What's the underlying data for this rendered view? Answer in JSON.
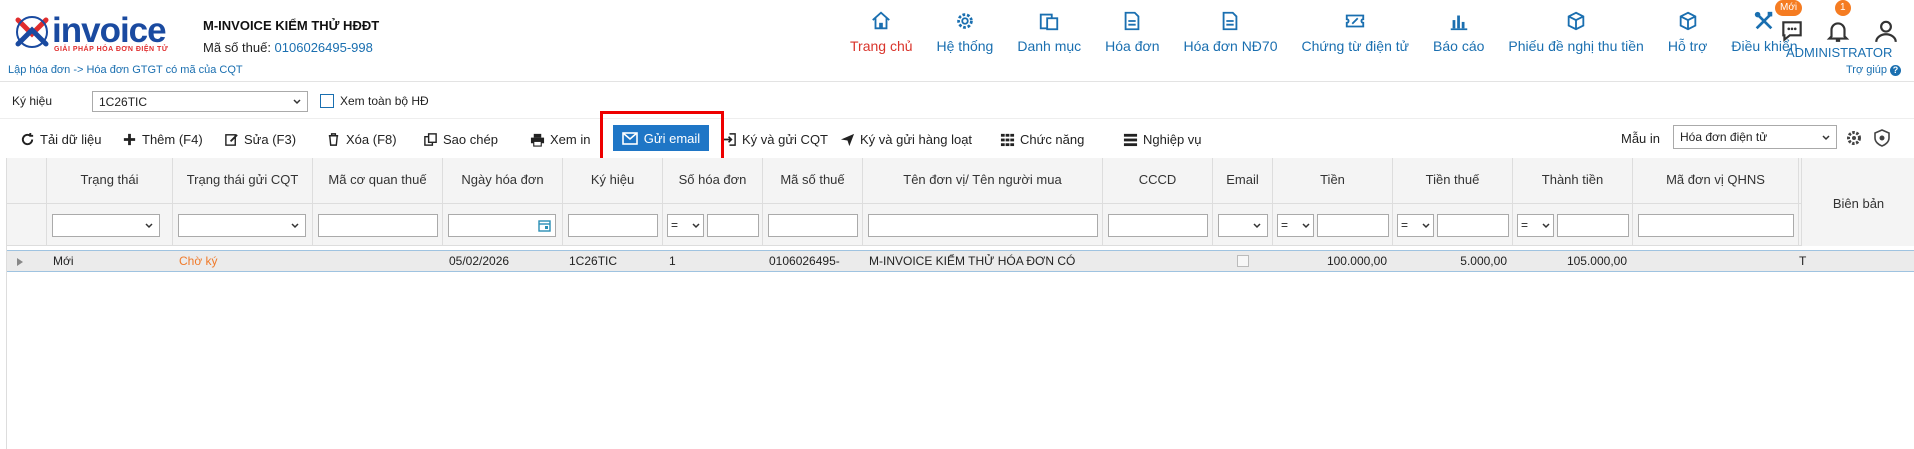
{
  "header": {
    "logo_text": "invoice",
    "logo_tagline": "GIẢI PHÁP HÓA ĐƠN ĐIỆN TỬ",
    "company_name": "M-INVOICE KIỂM THỬ HĐĐT",
    "tax_label": "Mã số thuế: ",
    "tax_code": "0106026495-998",
    "breadcrumb": "Lập hóa đơn -> Hóa đơn GTGT có mã của CQT",
    "nav": [
      {
        "label": "Trang chủ",
        "icon": "home-icon",
        "active": true
      },
      {
        "label": "Hệ thống",
        "icon": "gear-icon"
      },
      {
        "label": "Danh mục",
        "icon": "catalog-icon"
      },
      {
        "label": "Hóa đơn",
        "icon": "invoice-icon"
      },
      {
        "label": "Hóa đơn NĐ70",
        "icon": "invoice-nd70-icon"
      },
      {
        "label": "Chứng từ điện tử",
        "icon": "voucher-icon"
      },
      {
        "label": "Báo cáo",
        "icon": "chart-icon"
      },
      {
        "label": "Phiếu đề nghị thu tiền",
        "icon": "box-icon"
      },
      {
        "label": "Hỗ trợ",
        "icon": "support-icon"
      },
      {
        "label": "Điều khiển",
        "icon": "tools-icon"
      }
    ],
    "chat_badge": "Mới",
    "bell_badge": "1",
    "user_name": "ADMINISTRATOR",
    "help_label": "Trợ giúp"
  },
  "filter": {
    "kyhieu_label": "Ký hiệu",
    "kyhieu_value": "1C26TIC",
    "view_all_label": "Xem toàn bộ HĐ"
  },
  "toolbar": {
    "reload": "Tải dữ liệu",
    "add": "Thêm (F4)",
    "edit": "Sửa (F3)",
    "delete": "Xóa (F8)",
    "copy": "Sao chép",
    "print": "Xem in",
    "send_email": "Gửi email",
    "sign_send": "Ký và gửi CQT",
    "sign_batch": "Ký và gửi hàng loạt",
    "functions": "Chức năng",
    "operations": "Nghiệp vụ",
    "template_label": "Mẫu in",
    "template_value": "Hóa đơn điện tử"
  },
  "grid": {
    "columns": [
      "Trạng thái",
      "Trạng thái gửi CQT",
      "Mã cơ quan thuế",
      "Ngày hóa đơn",
      "Ký hiệu",
      "Số hóa đơn",
      "Mã số thuế",
      "Tên đơn vị/ Tên người mua",
      "CCCD",
      "Email",
      "Tiền",
      "Tiền thuế",
      "Thành tiền",
      "Mã đơn vị QHNS",
      "Biên bản"
    ],
    "op_equal": "=",
    "row": {
      "status": "Mới",
      "cqt_status": "Chờ ký",
      "tax_office": "",
      "date": "05/02/2026",
      "symbol": "1C26TIC",
      "number": "1",
      "tax_code": "0106026495-",
      "buyer": "M-INVOICE KIỂM THỬ HÓA ĐƠN CÓ",
      "cccd": "",
      "amount": "100.000,00",
      "tax": "5.000,00",
      "total": "105.000,00",
      "qhns": "",
      "extra": "T"
    }
  },
  "colors": {
    "primary": "#1a6fb0",
    "active": "#d9342b",
    "button": "#1f76c6",
    "highlight": "#e00000",
    "badge": "#f57c22"
  }
}
